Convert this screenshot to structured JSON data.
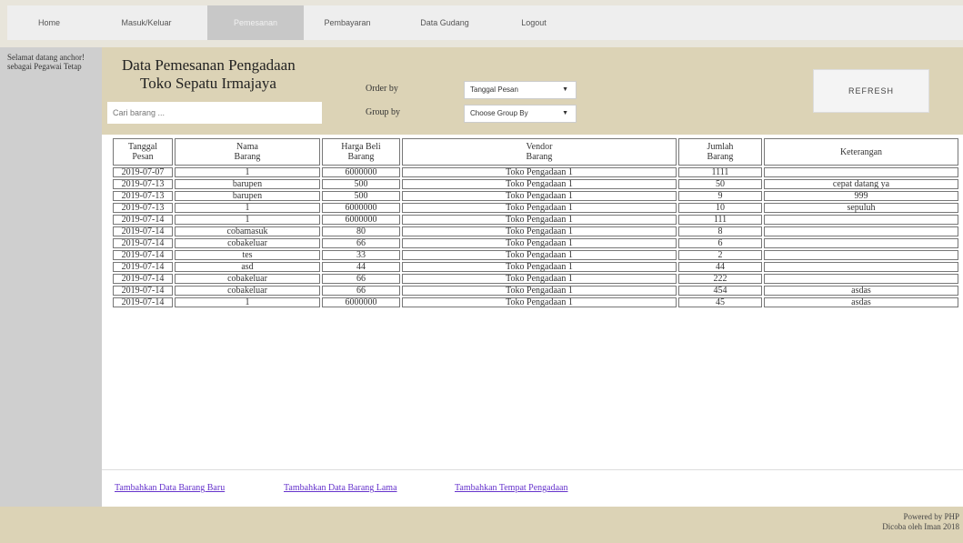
{
  "nav": {
    "items": [
      {
        "label": "Home"
      },
      {
        "label": "Masuk/Keluar"
      },
      {
        "label": "Pemesanan"
      },
      {
        "label": "Pembayaran"
      },
      {
        "label": "Data Gudang"
      },
      {
        "label": "Logout"
      }
    ]
  },
  "sidebar": {
    "greeting": "Selamat datang anchor! sebagai Pegawai Tetap"
  },
  "header": {
    "title_line1": "Data Pemesanan Pengadaan",
    "title_line2": "Toko Sepatu Irmajaya",
    "search_placeholder": "Cari barang ...",
    "order_by_label": "Order by",
    "order_by_value": "Tanggal Pesan",
    "group_by_label": "Group by",
    "group_by_value": "Choose Group By",
    "refresh_label": "REFRESH"
  },
  "table": {
    "headers": [
      "Tanggal\nPesan",
      "Nama\nBarang",
      "Harga Beli\nBarang",
      "Vendor\nBarang",
      "Jumlah\nBarang",
      "Keterangan"
    ],
    "rows": [
      [
        "2019-07-07",
        "1",
        "6000000",
        "Toko Pengadaan 1",
        "1111",
        ""
      ],
      [
        "2019-07-13",
        "barupen",
        "500",
        "Toko Pengadaan 1",
        "50",
        "cepat datang ya"
      ],
      [
        "2019-07-13",
        "barupen",
        "500",
        "Toko Pengadaan 1",
        "9",
        "999"
      ],
      [
        "2019-07-13",
        "1",
        "6000000",
        "Toko Pengadaan 1",
        "10",
        "sepuluh"
      ],
      [
        "2019-07-14",
        "1",
        "6000000",
        "Toko Pengadaan 1",
        "111",
        ""
      ],
      [
        "2019-07-14",
        "cobamasuk",
        "80",
        "Toko Pengadaan 1",
        "8",
        ""
      ],
      [
        "2019-07-14",
        "cobakeluar",
        "66",
        "Toko Pengadaan 1",
        "6",
        ""
      ],
      [
        "2019-07-14",
        "tes",
        "33",
        "Toko Pengadaan 1",
        "2",
        ""
      ],
      [
        "2019-07-14",
        "asd",
        "44",
        "Toko Pengadaan 1",
        "44",
        ""
      ],
      [
        "2019-07-14",
        "cobakeluar",
        "66",
        "Toko Pengadaan 1",
        "222",
        ""
      ],
      [
        "2019-07-14",
        "cobakeluar",
        "66",
        "Toko Pengadaan 1",
        "454",
        "asdas"
      ],
      [
        "2019-07-14",
        "1",
        "6000000",
        "Toko Pengadaan 1",
        "45",
        "asdas"
      ]
    ]
  },
  "links": {
    "add_new": "Tambahkan Data Barang Baru",
    "add_old": "Tambahkan Data Barang Lama",
    "add_vendor": "Tambahkan Tempat Pengadaan"
  },
  "footer": {
    "line1": "Powered by PHP",
    "line2": "Dicoba oleh Iman 2018"
  }
}
